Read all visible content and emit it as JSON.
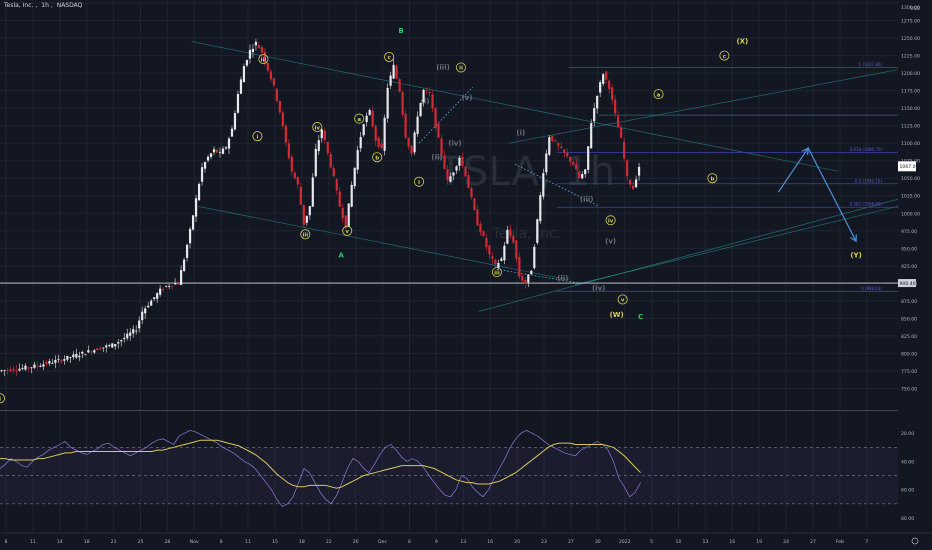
{
  "header": {
    "symbol": "Tesla, Inc.",
    "timeframe": "1h",
    "exchange": "NASDAQ",
    "watermark": "TSLA, 1h",
    "watermark_sub": "Tesla, Inc."
  },
  "colors": {
    "background": "#131722",
    "up": "#e8e8ee",
    "down": "#d32a35",
    "grid": "#1f2430",
    "label_yellow": "#d9d25b",
    "label_green": "#2ec76a",
    "channel": "#2fa4a4",
    "projection": "#4a8fd8",
    "fib": "#3f3fb0",
    "rsi": "#8e7ad8",
    "rsi_ma": "#d9c75a"
  },
  "chart_data": [
    {
      "type": "candlestick",
      "title": "Tesla, Inc., 1h, NASDAQ",
      "y_unit": "USD",
      "ylim": [
        725,
        1300
      ],
      "y_ticks": [
        750,
        775,
        800,
        825,
        850,
        875,
        900,
        925,
        950,
        975,
        1000,
        1025,
        1050,
        1075,
        1100,
        1125,
        1150,
        1175,
        1200,
        1225,
        1250,
        1275,
        1300
      ],
      "x_ticks": [
        "8",
        "11",
        "14",
        "18",
        "21",
        "25",
        "28",
        "Nov",
        "8",
        "11",
        "15",
        "18",
        "22",
        "26",
        "Dec",
        "6",
        "9",
        "13",
        "16",
        "20",
        "23",
        "27",
        "30",
        "2022",
        "5",
        "10",
        "13",
        "16",
        "19",
        "24",
        "27",
        "Feb",
        "7"
      ],
      "price_path": [
        [
          0,
          775
        ],
        [
          5,
          780
        ],
        [
          10,
          790
        ],
        [
          14,
          800
        ],
        [
          17,
          808
        ],
        [
          19,
          812
        ],
        [
          21,
          822
        ],
        [
          23,
          835
        ],
        [
          24,
          860
        ],
        [
          25,
          870
        ],
        [
          26,
          880
        ],
        [
          27,
          890
        ],
        [
          28,
          896
        ],
        [
          29,
          899
        ],
        [
          30,
          900
        ],
        [
          31,
          935
        ],
        [
          32,
          975
        ],
        [
          33,
          1020
        ],
        [
          34,
          1065
        ],
        [
          35,
          1080
        ],
        [
          36,
          1090
        ],
        [
          37,
          1085
        ],
        [
          38,
          1095
        ],
        [
          39,
          1120
        ],
        [
          40,
          1170
        ],
        [
          41,
          1210
        ],
        [
          42,
          1232
        ],
        [
          43,
          1243
        ],
        [
          44,
          1230
        ],
        [
          45,
          1205
        ],
        [
          46,
          1180
        ],
        [
          47,
          1145
        ],
        [
          48,
          1100
        ],
        [
          49,
          1060
        ],
        [
          50,
          1040
        ],
        [
          51,
          985
        ],
        [
          52,
          1010
        ],
        [
          53,
          1090
        ],
        [
          54,
          1120
        ],
        [
          55,
          1085
        ],
        [
          56,
          1050
        ],
        [
          57,
          1010
        ],
        [
          58,
          982
        ],
        [
          59,
          1040
        ],
        [
          60,
          1090
        ],
        [
          61,
          1130
        ],
        [
          62,
          1145
        ],
        [
          63,
          1105
        ],
        [
          64,
          1090
        ],
        [
          65,
          1180
        ],
        [
          66,
          1210
        ],
        [
          67,
          1175
        ],
        [
          68,
          1110
        ],
        [
          69,
          1085
        ],
        [
          70,
          1140
        ],
        [
          71,
          1175
        ],
        [
          72,
          1170
        ],
        [
          73,
          1125
        ],
        [
          74,
          1085
        ],
        [
          75,
          1045
        ],
        [
          76,
          1060
        ],
        [
          77,
          1080
        ],
        [
          78,
          1055
        ],
        [
          79,
          1020
        ],
        [
          80,
          985
        ],
        [
          81,
          965
        ],
        [
          82,
          940
        ],
        [
          83,
          925
        ],
        [
          84,
          935
        ],
        [
          85,
          975
        ],
        [
          86,
          960
        ],
        [
          87,
          910
        ],
        [
          88,
          900
        ],
        [
          89,
          920
        ],
        [
          90,
          990
        ],
        [
          91,
          1060
        ],
        [
          92,
          1110
        ],
        [
          93,
          1100
        ],
        [
          94,
          1090
        ],
        [
          95,
          1080
        ],
        [
          96,
          1070
        ],
        [
          97,
          1050
        ],
        [
          98,
          1060
        ],
        [
          99,
          1130
        ],
        [
          100,
          1170
        ],
        [
          101,
          1200
        ],
        [
          102,
          1180
        ],
        [
          103,
          1140
        ],
        [
          104,
          1105
        ],
        [
          105,
          1050
        ],
        [
          106,
          1035
        ],
        [
          107,
          1067
        ]
      ],
      "last_price": 1067.0,
      "key_level": 900.4,
      "fib_levels": [
        {
          "label": "1 (1207.86)",
          "value": 1207.86
        },
        {
          "label": "0.618 (1086.70)",
          "value": 1086.7
        },
        {
          "label": "0.5 (1042.10)",
          "value": 1042.1
        },
        {
          "label": "0.382 (1008.60)",
          "value": 1008.6
        },
        {
          "label": "0 (888.61)",
          "value": 888.61
        }
      ],
      "wave_labels": [
        {
          "text": "i",
          "color": "yellow",
          "circled": true,
          "t": 0,
          "v": 736
        },
        {
          "text": "iii",
          "color": "yellow",
          "circled": true,
          "t": 44,
          "v": 1220
        },
        {
          "text": "i",
          "color": "yellow",
          "circled": true,
          "t": 43,
          "v": 1110
        },
        {
          "text": "iv",
          "color": "yellow",
          "circled": true,
          "t": 53,
          "v": 1123
        },
        {
          "text": "iii",
          "color": "yellow",
          "circled": true,
          "t": 51,
          "v": 970
        },
        {
          "text": "v",
          "color": "yellow",
          "circled": true,
          "t": 58,
          "v": 975
        },
        {
          "text": "A",
          "color": "green",
          "circled": false,
          "t": 57,
          "v": 940
        },
        {
          "text": "a",
          "color": "yellow",
          "circled": true,
          "t": 60,
          "v": 1135
        },
        {
          "text": "b",
          "color": "yellow",
          "circled": true,
          "t": 63,
          "v": 1080
        },
        {
          "text": "c",
          "color": "yellow",
          "circled": true,
          "t": 65,
          "v": 1223
        },
        {
          "text": "B",
          "color": "green",
          "circled": false,
          "t": 67,
          "v": 1260
        },
        {
          "text": "(iii)",
          "color": "gray",
          "circled": false,
          "t": 74,
          "v": 1208
        },
        {
          "text": "ii",
          "color": "yellow",
          "circled": true,
          "t": 77,
          "v": 1208
        },
        {
          "text": "(i)",
          "color": "gray",
          "circled": false,
          "t": 71,
          "v": 1160
        },
        {
          "text": "(v)",
          "color": "gray",
          "circled": false,
          "t": 78,
          "v": 1165
        },
        {
          "text": "(iv)",
          "color": "gray",
          "circled": false,
          "t": 76,
          "v": 1100
        },
        {
          "text": "(ii)",
          "color": "gray",
          "circled": false,
          "t": 73,
          "v": 1080
        },
        {
          "text": "i",
          "color": "yellow",
          "circled": true,
          "t": 70,
          "v": 1045
        },
        {
          "text": "(i)",
          "color": "gray",
          "circled": false,
          "t": 87,
          "v": 1115
        },
        {
          "text": "(iii)",
          "color": "gray",
          "circled": false,
          "t": 98,
          "v": 1020
        },
        {
          "text": "iv",
          "color": "yellow",
          "circled": true,
          "t": 102,
          "v": 990
        },
        {
          "text": "(v)",
          "color": "gray",
          "circled": false,
          "t": 102,
          "v": 960
        },
        {
          "text": "iii",
          "color": "yellow",
          "circled": true,
          "t": 83,
          "v": 916
        },
        {
          "text": "(ii)",
          "color": "gray",
          "circled": false,
          "t": 94,
          "v": 907
        },
        {
          "text": "(iv)",
          "color": "gray",
          "circled": false,
          "t": 100,
          "v": 893
        },
        {
          "text": "v",
          "color": "yellow",
          "circled": true,
          "t": 104,
          "v": 877
        },
        {
          "text": "(W)",
          "color": "yellow",
          "circled": false,
          "t": 103,
          "v": 855
        },
        {
          "text": "C",
          "color": "green",
          "circled": false,
          "t": 107,
          "v": 852
        },
        {
          "text": "a",
          "color": "yellow",
          "circled": true,
          "t": 110,
          "v": 1170
        },
        {
          "text": "b",
          "color": "yellow",
          "circled": true,
          "t": 119,
          "v": 1050
        },
        {
          "text": "c",
          "color": "yellow",
          "circled": true,
          "t": 121,
          "v": 1225
        },
        {
          "text": "(X)",
          "color": "yellow",
          "circled": false,
          "t": 124,
          "v": 1245
        },
        {
          "text": "(Y)",
          "color": "yellow",
          "circled": false,
          "t": 143,
          "v": 940
        }
      ],
      "projection_path": [
        [
          130,
          1030
        ],
        [
          135,
          1093
        ],
        [
          143,
          960
        ]
      ]
    },
    {
      "type": "line",
      "title": "RSI",
      "ylim": [
        10,
        95
      ],
      "y_ticks": [
        20,
        40,
        60,
        80
      ],
      "levels": [
        70,
        50,
        30
      ],
      "series": [
        {
          "values": [
            55,
            58,
            62,
            60,
            57,
            56,
            60,
            63,
            65,
            68,
            70,
            72,
            74,
            70,
            68,
            66,
            65,
            67,
            69,
            72,
            73,
            70,
            68,
            66,
            64,
            66,
            68,
            70,
            73,
            75,
            76,
            74,
            72,
            78,
            80,
            82,
            81,
            79,
            77,
            75,
            73,
            70,
            68,
            66,
            63,
            60,
            58,
            55,
            50,
            45,
            40,
            33,
            28,
            30,
            35,
            45,
            55,
            52,
            45,
            38,
            33,
            30,
            36,
            45,
            55,
            62,
            60,
            55,
            52,
            58,
            65,
            70,
            72,
            68,
            63,
            60,
            62,
            60,
            56,
            50,
            45,
            40,
            36,
            35,
            40,
            50,
            48,
            42,
            38,
            35,
            40,
            48,
            55,
            62,
            70,
            76,
            80,
            82,
            80,
            78,
            75,
            72,
            70,
            68,
            66,
            65,
            64,
            68,
            70,
            72,
            74,
            72,
            68,
            60,
            48,
            42,
            35,
            38,
            45
          ]
        },
        {
          "values": [
            62,
            62,
            61,
            61,
            61,
            61,
            61,
            62,
            62,
            63,
            64,
            65,
            66,
            66,
            67,
            67,
            67,
            67,
            67,
            67,
            67,
            67,
            67,
            67,
            67,
            67,
            67,
            67,
            67,
            68,
            68,
            69,
            70,
            71,
            72,
            73,
            74,
            75,
            75,
            75,
            75,
            74,
            73,
            72,
            71,
            69,
            67,
            65,
            62,
            59,
            55,
            51,
            48,
            45,
            43,
            42,
            42,
            43,
            43,
            43,
            43,
            42,
            41,
            42,
            44,
            46,
            48,
            50,
            51,
            52,
            53,
            54,
            55,
            56,
            57,
            57,
            57,
            57,
            57,
            56,
            55,
            53,
            51,
            49,
            47,
            46,
            45,
            45,
            44,
            44,
            44,
            45,
            46,
            48,
            50,
            52,
            55,
            58,
            61,
            64,
            67,
            70,
            72,
            73,
            73,
            73,
            72,
            72,
            72,
            72,
            72,
            72,
            71,
            70,
            67,
            64,
            60,
            56,
            52
          ]
        }
      ]
    }
  ],
  "rsi_labels": [
    "80.00",
    "60.00",
    "40.00",
    "20.00"
  ]
}
